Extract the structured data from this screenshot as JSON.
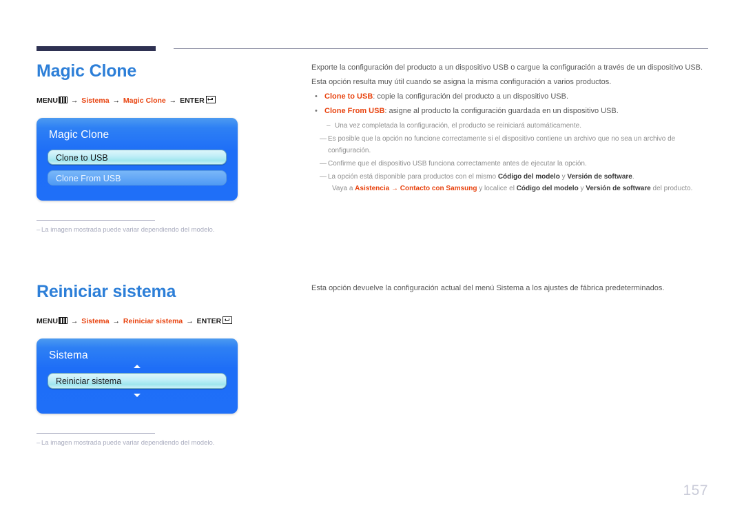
{
  "page": {
    "number": "157"
  },
  "sections": [
    {
      "id": "magic-clone",
      "heading": "Magic Clone",
      "menu_path": {
        "menu_label": "MENU",
        "menu_icon": "menu-bars-icon",
        "arrow": "→",
        "crumb1": "Sistema",
        "crumb2": "Magic Clone",
        "enter_label": "ENTER",
        "enter_icon": "enter-return-icon"
      },
      "osd": {
        "title": "Magic Clone",
        "has_scroll_arrows": false,
        "items": [
          {
            "label": "Clone to USB",
            "state": "selected"
          },
          {
            "label": "Clone From USB",
            "state": "normal"
          }
        ]
      },
      "footnote": "La imagen mostrada puede variar dependiendo del modelo.",
      "footnote_dash": "–",
      "body": {
        "paragraphs": [
          "Exporte la configuración del producto a un dispositivo USB o cargue la configuración a través de un dispositivo USB.",
          "Esta opción resulta muy útil cuando se asigna la misma configuración a varios productos."
        ],
        "bullets": [
          {
            "mark": "•",
            "term": "Clone to USB",
            "rest": ": copie la configuración del producto a un dispositivo USB."
          },
          {
            "mark": "•",
            "term": "Clone From USB",
            "rest": ": asigne al producto la configuración guardada en un dispositivo USB."
          }
        ],
        "sub_note": {
          "mark": "–",
          "text": "Una vez completada la configuración, el producto se reiniciará automáticamente."
        },
        "notes": [
          {
            "mark": "—",
            "text": "Es posible que la opción no funcione correctamente si el dispositivo contiene un archivo que no sea un archivo de configuración."
          },
          {
            "mark": "—",
            "text": "Confirme que el dispositivo USB funciona correctamente antes de ejecutar la opción."
          }
        ],
        "rich_note": {
          "mark": "—",
          "line1_a": "La opción está disponible para productos con el mismo ",
          "line1_b": "Código del modelo",
          "line1_c": " y ",
          "line1_d": "Versión de software",
          "line1_e": ".",
          "line2_a": "Vaya a ",
          "line2_b": "Asistencia",
          "line2_arrow": " → ",
          "line2_c": "Contacto con Samsung",
          "line2_d": " y localice el ",
          "line2_e": "Código del modelo",
          "line2_f": " y ",
          "line2_g": "Versión de software",
          "line2_h": " del producto."
        }
      }
    },
    {
      "id": "reiniciar-sistema",
      "heading": "Reiniciar sistema",
      "menu_path": {
        "menu_label": "MENU",
        "menu_icon": "menu-bars-icon",
        "arrow": "→",
        "crumb1": "Sistema",
        "crumb2": "Reiniciar sistema",
        "enter_label": "ENTER",
        "enter_icon": "enter-return-icon"
      },
      "osd": {
        "title": "Sistema",
        "has_scroll_arrows": true,
        "items": [
          {
            "label": "Reiniciar sistema",
            "state": "selected"
          }
        ]
      },
      "footnote": "La imagen mostrada puede variar dependiendo del modelo.",
      "footnote_dash": "–",
      "body": {
        "paragraphs": [
          "Esta opción devuelve la configuración actual del menú Sistema a los ajustes de fábrica predeterminados."
        ]
      }
    }
  ],
  "colors": {
    "heading_blue": "#2d7fd8",
    "accent_red": "#e8430f",
    "rule_navy": "#2e3152",
    "osd_blue": "#1f6ff8",
    "osd_selected": "#bfeef7",
    "page_number_gray": "#c9cbd8"
  }
}
